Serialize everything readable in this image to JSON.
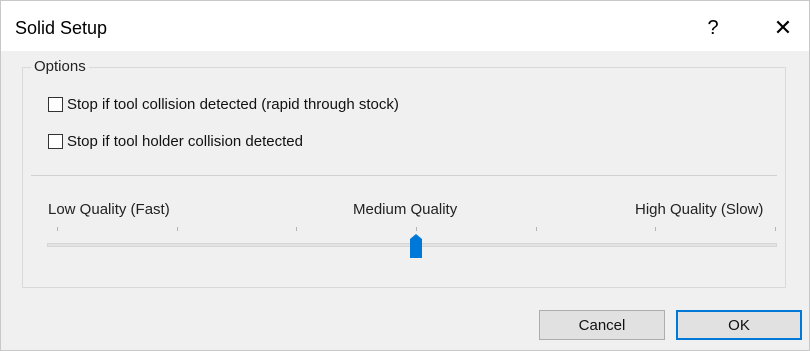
{
  "window": {
    "title": "Solid Setup",
    "help_glyph": "?",
    "close_glyph": "✕"
  },
  "options": {
    "group_label": "Options",
    "checkboxes": [
      {
        "label": "Stop if tool collision detected (rapid through stock)",
        "checked": false
      },
      {
        "label": "Stop if tool holder collision detected",
        "checked": false
      }
    ]
  },
  "quality": {
    "low_label": "Low Quality (Fast)",
    "medium_label": "Medium Quality",
    "high_label": "High Quality (Slow)",
    "tick_count": 7,
    "value": 3,
    "min": 0,
    "max": 6,
    "thumb_color": "#0078d7"
  },
  "buttons": {
    "cancel_label": "Cancel",
    "ok_label": "OK",
    "default_color": "#0078d7"
  }
}
